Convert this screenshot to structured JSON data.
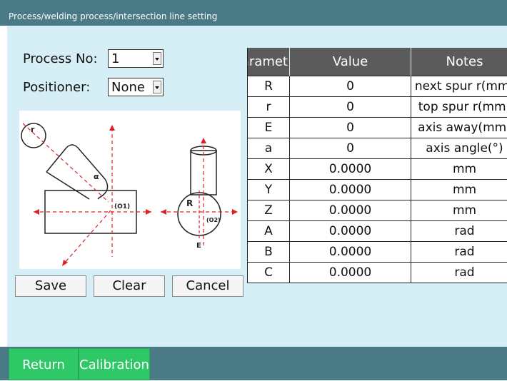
{
  "window": {
    "title": "Process/welding process/intersection line setting"
  },
  "form": {
    "process_no_label": "Process No:",
    "process_no_value": "1",
    "positioner_label": "Positioner:",
    "positioner_value": "None"
  },
  "diagram": {
    "labels": {
      "r": "r",
      "alpha": "α",
      "o1": "(O1)",
      "R": "R",
      "o2": "(O2)",
      "E": "E"
    }
  },
  "actions": {
    "save": "Save",
    "clear": "Clear",
    "cancel": "Cancel"
  },
  "table": {
    "headers": [
      "Paramet",
      "Value",
      "Notes"
    ],
    "rows": [
      {
        "param": "R",
        "value": "0",
        "note": "next spur r(mm)"
      },
      {
        "param": "r",
        "value": "0",
        "note": "top spur r(mm)"
      },
      {
        "param": "E",
        "value": "0",
        "note": "axis away(mm)"
      },
      {
        "param": "a",
        "value": "0",
        "note": "axis angle(°)"
      },
      {
        "param": "X",
        "value": "0.0000",
        "note": "mm"
      },
      {
        "param": "Y",
        "value": "0.0000",
        "note": "mm"
      },
      {
        "param": "Z",
        "value": "0.0000",
        "note": "mm"
      },
      {
        "param": "A",
        "value": "0.0000",
        "note": "rad"
      },
      {
        "param": "B",
        "value": "0.0000",
        "note": "rad"
      },
      {
        "param": "C",
        "value": "0.0000",
        "note": "rad"
      }
    ]
  },
  "bottom": {
    "return": "Return",
    "calibration": "Calibration"
  },
  "colors": {
    "titlebar": "#4a7a86",
    "panel": "#d6eef6",
    "green_button": "#2ec866",
    "header": "#5b5b5b",
    "diagram_red": "#e02020"
  }
}
